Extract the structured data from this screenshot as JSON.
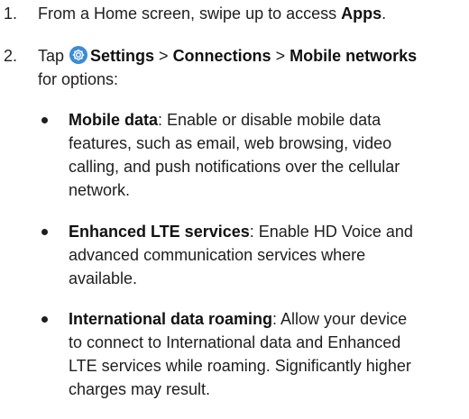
{
  "steps": [
    {
      "number": "1.",
      "prefix": "From a Home screen, swipe up to access ",
      "bold": "Apps",
      "suffix": "."
    },
    {
      "number": "2.",
      "prefix": "Tap ",
      "icon": "settings-gear-icon",
      "path1": "Settings",
      "sep1": " > ",
      "path2": "Connections",
      "sep2": " > ",
      "path3": "Mobile networks",
      "line2": "for options:"
    }
  ],
  "options": [
    {
      "term": "Mobile data",
      "lines": [
        ": Enable or disable mobile data",
        "features, such as email, web browsing, video",
        "calling, and push notifications over the cellular",
        "network."
      ]
    },
    {
      "term": "Enhanced LTE services",
      "lines": [
        ": Enable HD Voice and",
        "advanced communication services where",
        "available."
      ]
    },
    {
      "term": "International data roaming",
      "lines": [
        ": Allow your device",
        "to connect to International data and Enhanced",
        "LTE services while roaming. Significantly higher",
        "charges may result."
      ]
    }
  ],
  "colors": {
    "icon_bg": "#3a8cd6",
    "text": "#1e1e1e"
  }
}
